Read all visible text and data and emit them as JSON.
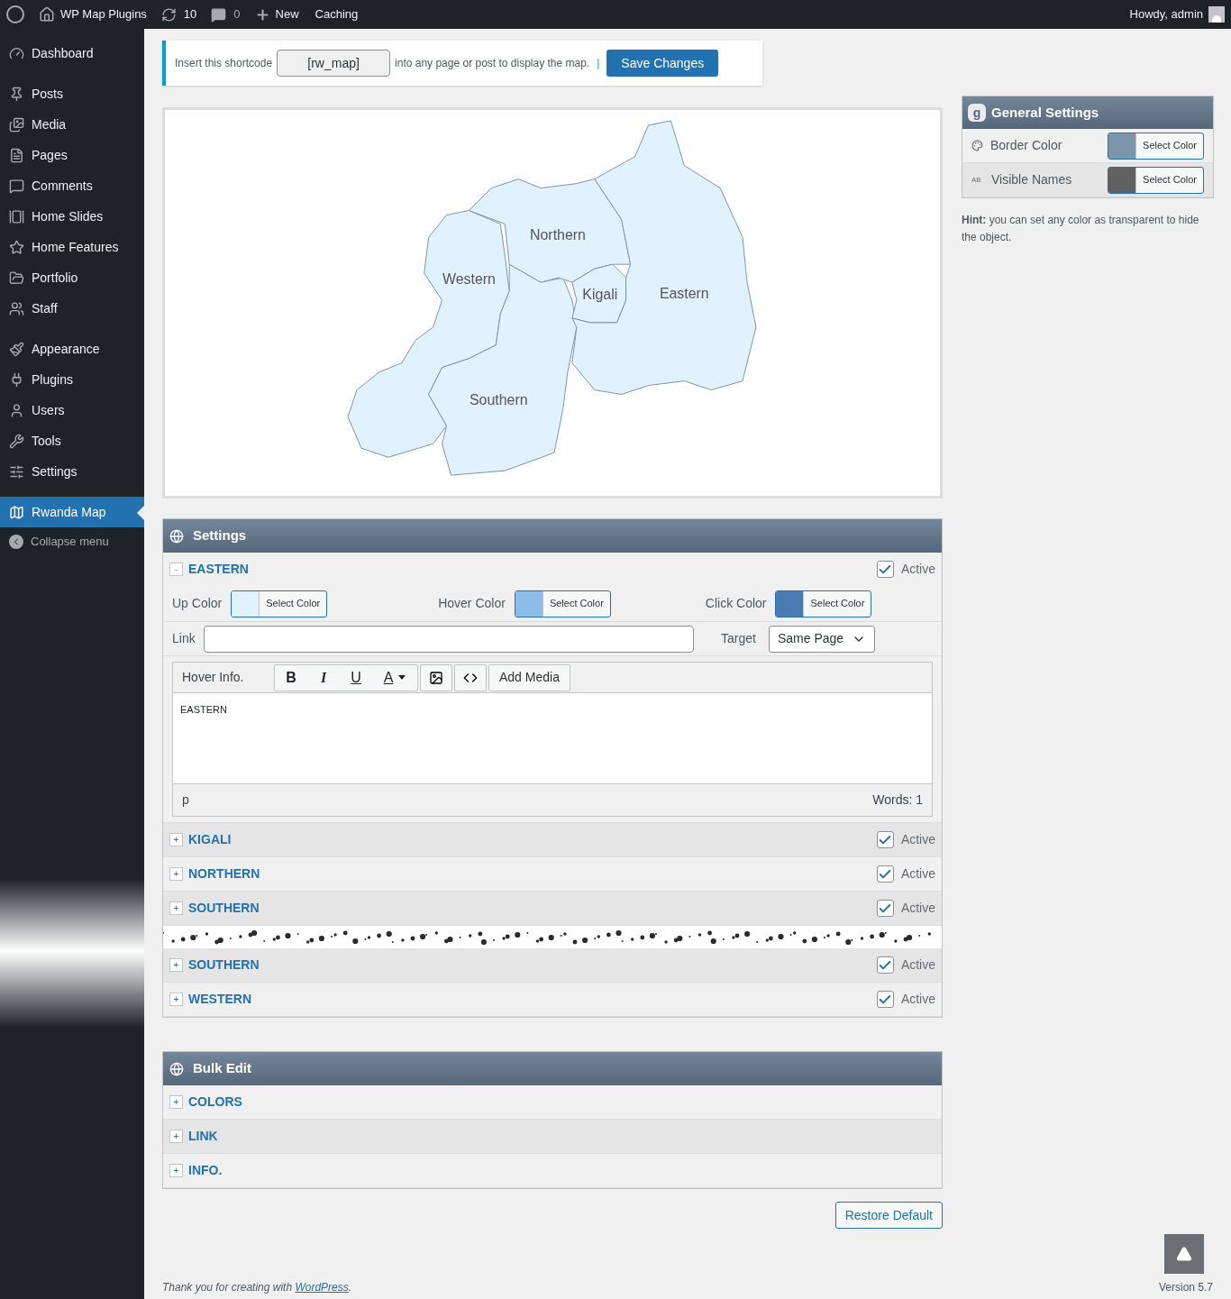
{
  "admin_bar": {
    "site": "WP Map Plugins",
    "updates": "10",
    "comments": "0",
    "new": "New",
    "caching": "Caching",
    "greeting": "Howdy, admin"
  },
  "sidebar": {
    "groups": [
      {
        "items": [
          {
            "label": "Dashboard",
            "selected": false
          }
        ]
      },
      {
        "items": [
          {
            "label": "Posts",
            "selected": false
          },
          {
            "label": "Media",
            "selected": false
          },
          {
            "label": "Pages",
            "selected": false
          },
          {
            "label": "Comments",
            "selected": false
          },
          {
            "label": "Home Slides",
            "selected": false
          },
          {
            "label": "Home Features",
            "selected": false
          },
          {
            "label": "Portfolio",
            "selected": false
          },
          {
            "label": "Staff",
            "selected": false
          }
        ]
      },
      {
        "items": [
          {
            "label": "Appearance",
            "selected": false
          },
          {
            "label": "Plugins",
            "selected": false
          },
          {
            "label": "Users",
            "selected": false
          },
          {
            "label": "Tools",
            "selected": false
          },
          {
            "label": "Settings",
            "selected": false
          }
        ]
      },
      {
        "items": [
          {
            "label": "Rwanda Map",
            "selected": true
          }
        ]
      }
    ],
    "collapse": "Collapse menu"
  },
  "notice": {
    "before": "Insert this shortcode",
    "shortcode": "[rw_map]",
    "after": "into any page or post to display the map.",
    "separator": "|",
    "save": "Save Changes"
  },
  "map": {
    "regions": [
      {
        "name": "Western"
      },
      {
        "name": "Southern"
      },
      {
        "name": "Northern"
      },
      {
        "name": "Kigali"
      },
      {
        "name": "Eastern"
      }
    ]
  },
  "settings": {
    "title": "Settings",
    "regions": [
      {
        "kind": "region",
        "name": "EASTERN",
        "toggle": "-",
        "expanded": true,
        "active": true,
        "active_label": "Active",
        "colors": [
          {
            "label": "Up Color",
            "color": "#e1f1fd",
            "button": "Select Color"
          },
          {
            "label": "Hover Color",
            "color": "#8cbde8",
            "button": "Select Color"
          },
          {
            "label": "Click Color",
            "color": "#4a7bb0",
            "button": "Select Color"
          }
        ],
        "link": {
          "label": "Link"
        },
        "target": {
          "label": "Target",
          "value": "Same Page"
        },
        "editor": {
          "label": "Hover Info.",
          "format": [
            "B",
            "I",
            "U",
            "A"
          ],
          "add_media": "Add Media",
          "content": "EASTERN",
          "path": "p",
          "words": "Words: 1"
        }
      },
      {
        "kind": "region",
        "name": "KIGALI",
        "toggle": "+",
        "expanded": false,
        "active": true,
        "active_label": "Active"
      },
      {
        "kind": "region",
        "name": "NORTHERN",
        "toggle": "+",
        "expanded": false,
        "active": true,
        "active_label": "Active"
      },
      {
        "kind": "region",
        "name": "SOUTHERN",
        "toggle": "+",
        "expanded": false,
        "active": true,
        "active_label": "Active"
      },
      {
        "kind": "tear"
      },
      {
        "kind": "region",
        "name": "SOUTHERN",
        "toggle": "+",
        "expanded": false,
        "active": true,
        "active_label": "Active"
      },
      {
        "kind": "region",
        "name": "WESTERN",
        "toggle": "+",
        "expanded": false,
        "active": true,
        "active_label": "Active"
      }
    ]
  },
  "bulk_edit": {
    "title": "Bulk Edit",
    "items": [
      {
        "name": "COLORS",
        "toggle": "+"
      },
      {
        "name": "LINK",
        "toggle": "+"
      },
      {
        "name": "INFO.",
        "toggle": "+"
      }
    ]
  },
  "restore": "Restore Default",
  "general_settings": {
    "title": "General Settings",
    "logo": "g",
    "rows": [
      {
        "label": "Border Color",
        "icon_text": "",
        "color": "#7b95ab",
        "button": "Select Color"
      },
      {
        "label": "Visible Names",
        "icon_text": "AB",
        "color": "#616161",
        "button": "Select Color"
      }
    ],
    "hint_label": "Hint:",
    "hint": "you can set any color as transparent to hide the object."
  },
  "footer": {
    "text": "Thank you for creating with",
    "link": "WordPress",
    "end": ".",
    "version": "Version 5.7"
  }
}
